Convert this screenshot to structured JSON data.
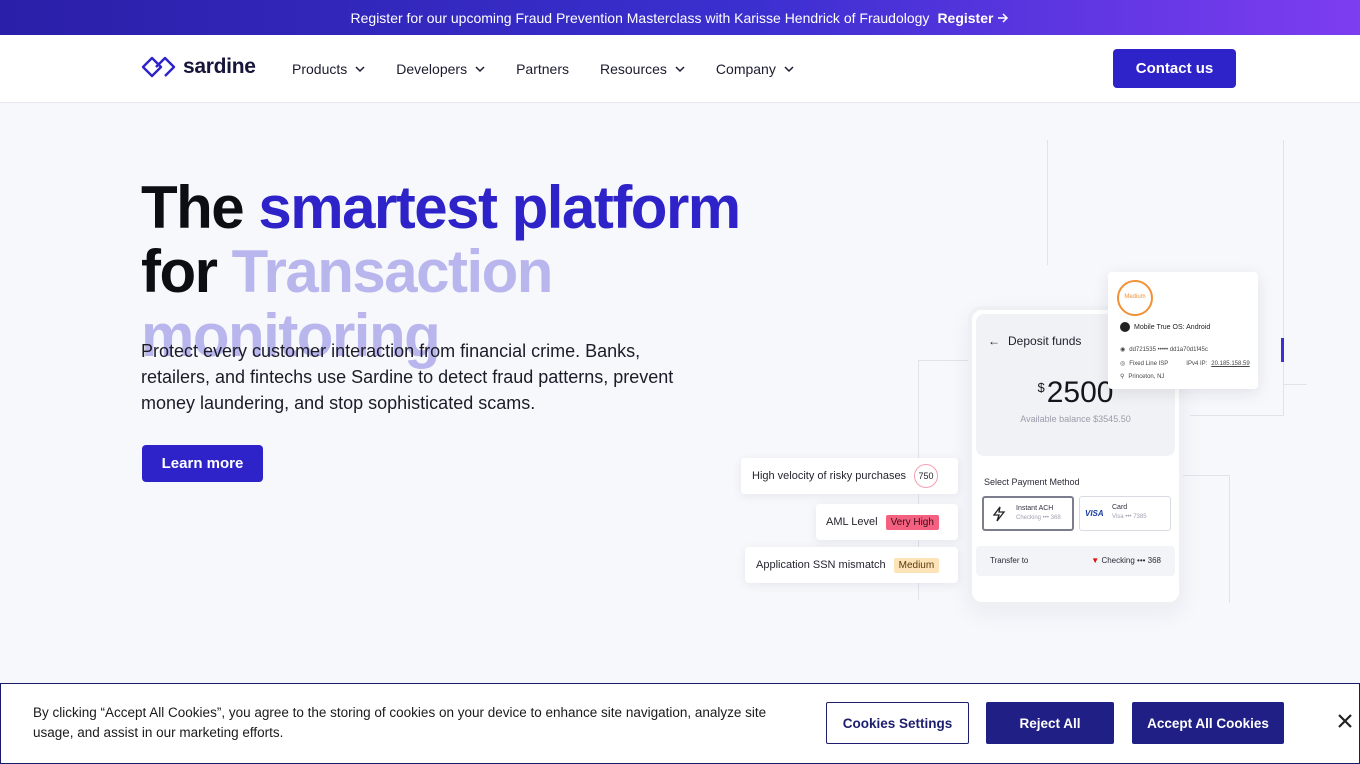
{
  "announcement": {
    "message": "Register for our upcoming Fraud Prevention Masterclass with Karisse Hendrick of Fraudology",
    "cta": "Register"
  },
  "nav": {
    "logo_text": "sardine",
    "items": [
      {
        "label": "Products",
        "dropdown": true
      },
      {
        "label": "Developers",
        "dropdown": true
      },
      {
        "label": "Partners",
        "dropdown": false
      },
      {
        "label": "Resources",
        "dropdown": true
      },
      {
        "label": "Company",
        "dropdown": true
      }
    ],
    "contact_label": "Contact us"
  },
  "hero": {
    "title_word1": "The",
    "title_accent": "smartest platform",
    "title_word2": "for",
    "title_light": "Transaction monitoring",
    "description": "Protect every customer interaction from financial crime. Banks, retailers, and fintechs use Sardine to detect fraud patterns, prevent money laundering, and stop sophisticated scams.",
    "cta": "Learn more"
  },
  "illustration": {
    "deposit_title": "Deposit funds",
    "currency": "$",
    "amount": "2500",
    "available": "Available balance $3545.50",
    "select_method": "Select Payment Method",
    "ach_title": "Instant ACH",
    "ach_sub": "Checking ••• 368",
    "card_title": "Card",
    "card_sub": "Visa ••• 7385",
    "visa": "VISA",
    "transfer_to": "Transfer to",
    "transfer_account": "Checking ••• 368",
    "signals": [
      {
        "label": "High velocity of risky purchases",
        "value": "750"
      },
      {
        "label": "AML Level",
        "value": "Very High"
      },
      {
        "label": "Application SSN mismatch",
        "value": "Medium"
      }
    ],
    "device": {
      "risk": "Medium",
      "os": "Mobile True OS: Android",
      "id": "dd721535 ••••• dd1a70d1f45c",
      "isp": "Fixed Line ISP",
      "isp_ip_label": "IPv4 IP:",
      "isp_ip": "20.185.158.59",
      "location": "Princeton, NJ"
    },
    "colors": {
      "very_high_bg": "#f4607f",
      "medium_bg": "#fde3b8",
      "score_ring": "#f4a0b4"
    }
  },
  "cookie": {
    "text": "By clicking “Accept All Cookies”, you agree to the storing of cookies on your device to enhance site navigation, analyze site usage, and assist in our marketing efforts.",
    "settings": "Cookies Settings",
    "reject": "Reject All",
    "accept": "Accept All Cookies"
  }
}
